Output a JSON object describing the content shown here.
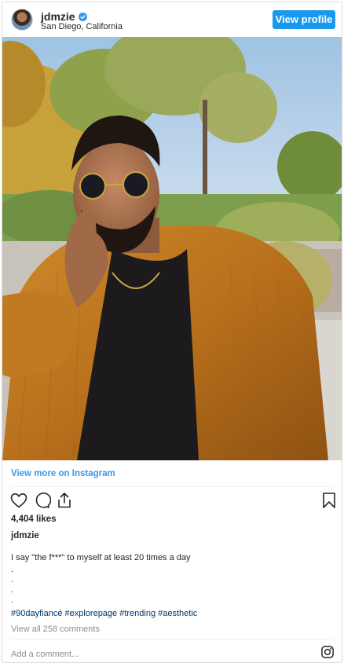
{
  "header": {
    "username": "jdmzie",
    "location": "San Diego, California",
    "view_profile_label": "View profile",
    "verified": true
  },
  "photo": {
    "description_icon": "post-photo"
  },
  "view_more_label": "View more on Instagram",
  "actions": {
    "icons": [
      "heart-icon",
      "comment-icon",
      "share-icon",
      "bookmark-icon"
    ]
  },
  "post": {
    "likes": "4,404 likes",
    "caption_username": "jdmzie",
    "caption_text": "I say \"the f***\" to myself at least 20 times a day",
    "caption_dots": [
      ".",
      ".",
      ".",
      "."
    ],
    "hashtags": "#90dayfiancé #explorepage #trending #aesthetic",
    "view_comments": "View all 258 comments",
    "add_comment_placeholder": "Add a comment..."
  },
  "colors": {
    "accent": "#3897f0",
    "button": "#1998f0",
    "hashtag": "#00376b",
    "muted": "#8e8e8e"
  }
}
